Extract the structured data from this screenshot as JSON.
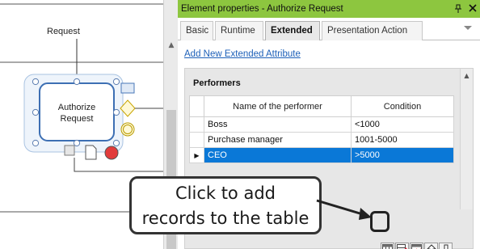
{
  "diagram": {
    "flow_label": "Request",
    "task_label_line1": "Authorize",
    "task_label_line2": "Request"
  },
  "panel": {
    "title": "Element properties - Authorize Request",
    "titlebar_icons": [
      "pin-icon",
      "close-icon"
    ],
    "tabs": [
      {
        "label": "Basic",
        "active": false
      },
      {
        "label": "Runtime",
        "active": false
      },
      {
        "label": "Extended",
        "active": true
      },
      {
        "label": "Presentation Action",
        "active": false
      }
    ],
    "add_attribute_link": "Add New Extended Attribute"
  },
  "grid": {
    "title": "Performers",
    "columns": [
      "Name of the performer",
      "Condition"
    ],
    "rows": [
      {
        "name": "Boss",
        "condition": "<1000",
        "selected": false
      },
      {
        "name": "Purchase manager",
        "condition": "1001-5000",
        "selected": false
      },
      {
        "name": "CEO",
        "condition": ">5000",
        "selected": true
      }
    ],
    "current_row_marker": "▶",
    "toolbar_buttons": [
      "add-record-icon",
      "edit-record-icon",
      "delete-record-icon",
      "move-up-icon",
      "move-down-icon"
    ]
  },
  "callout": {
    "line1": "Click to add",
    "line2": "records to the table"
  },
  "colors": {
    "titlebar": "#8dc63f",
    "selection": "#0a78d7",
    "link": "#1c5fb8",
    "task_border": "#4a78b8"
  }
}
